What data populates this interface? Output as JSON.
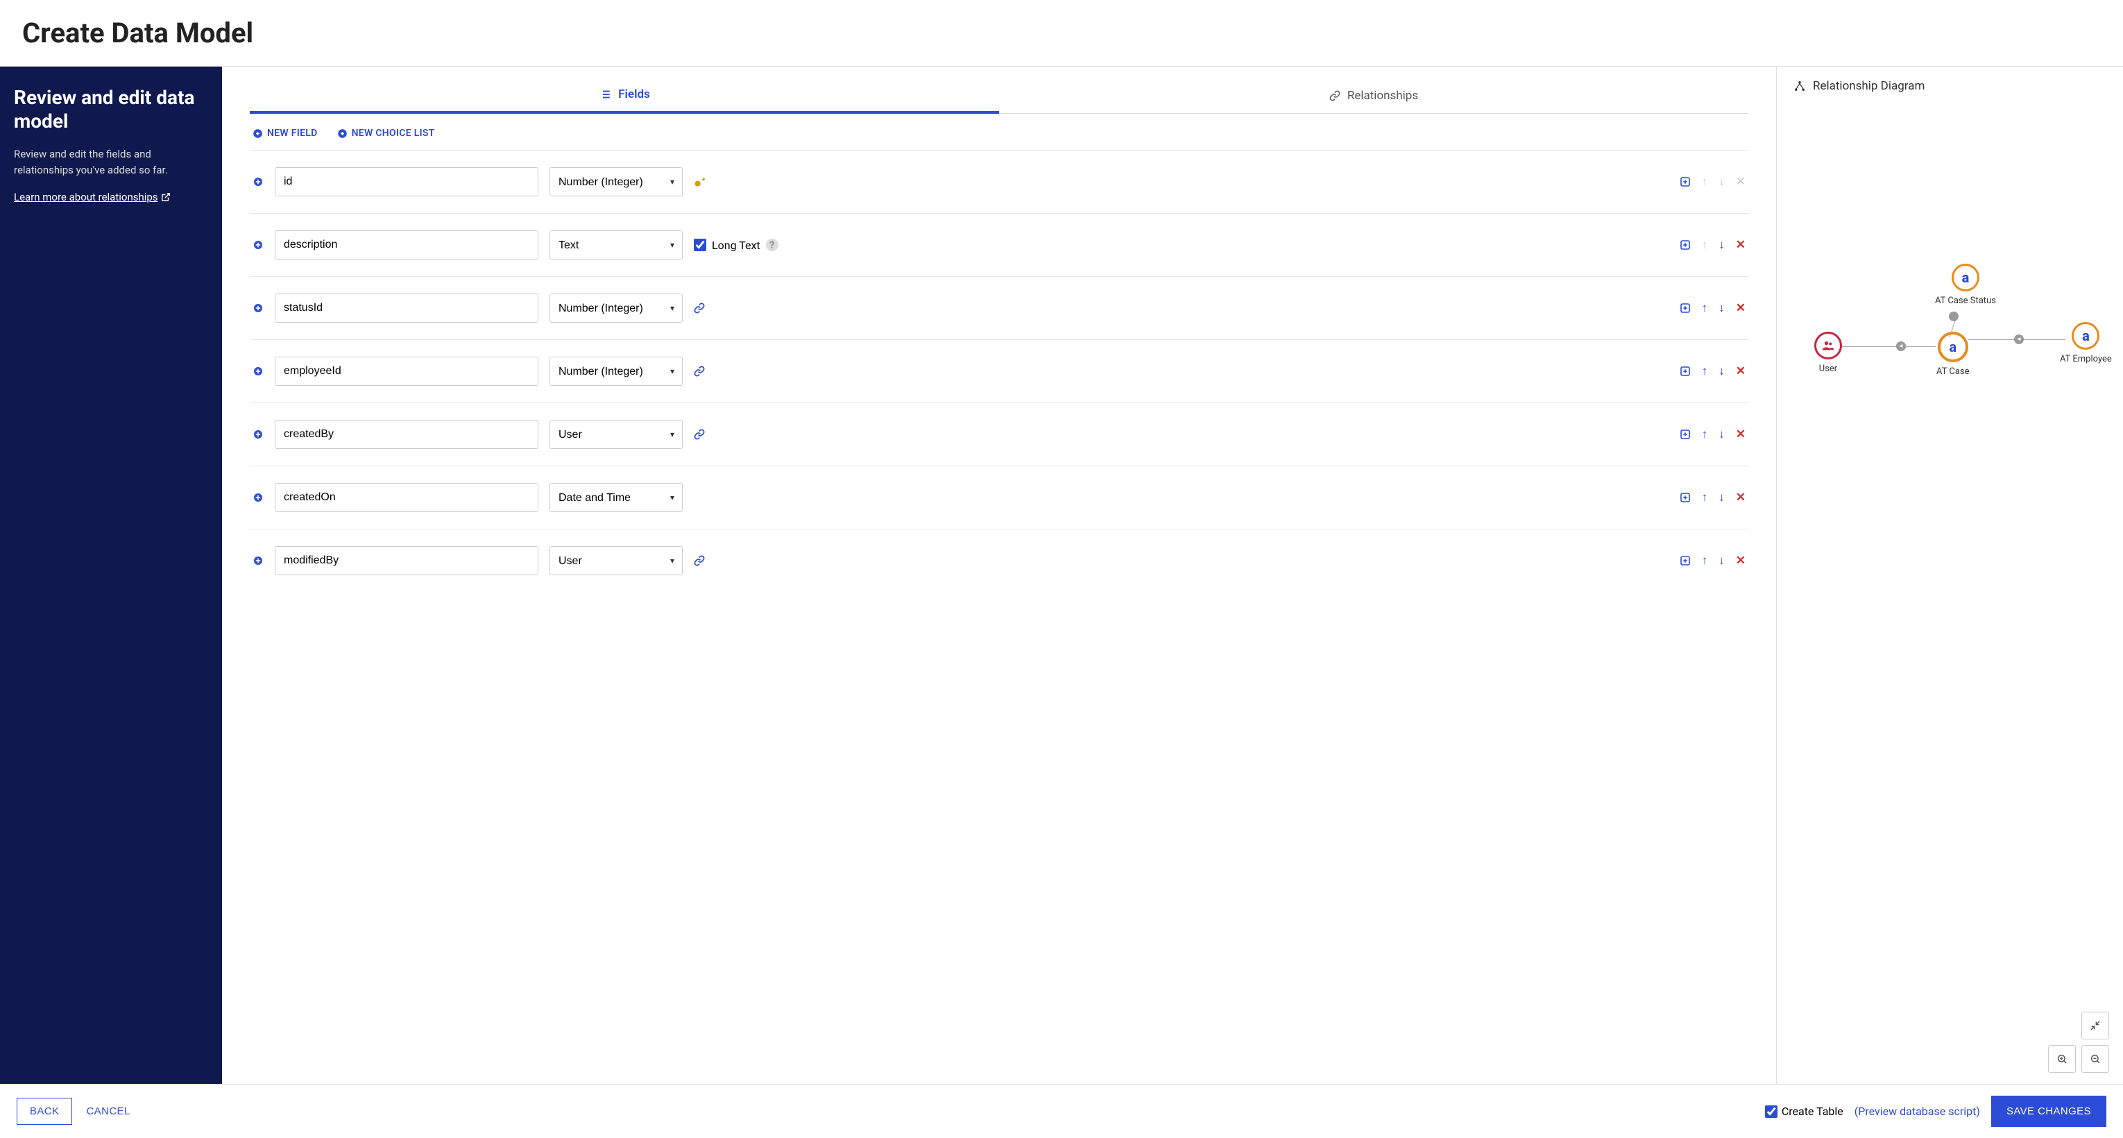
{
  "header": {
    "title": "Create Data Model"
  },
  "sidebar": {
    "heading": "Review and edit data model",
    "description": "Review and edit the fields and relationships you've added so far.",
    "learn_more": "Learn more about relationships"
  },
  "tabs": {
    "fields": "Fields",
    "relationships": "Relationships"
  },
  "actions": {
    "new_field": "NEW FIELD",
    "new_choice_list": "NEW CHOICE LIST"
  },
  "fields": [
    {
      "name": "id",
      "type": "Number (Integer)",
      "primary_key": true,
      "up_disabled": true,
      "down_disabled": true,
      "remove_disabled": true
    },
    {
      "name": "description",
      "type": "Text",
      "long_text": true,
      "long_text_label": "Long Text",
      "up_disabled": true
    },
    {
      "name": "statusId",
      "type": "Number (Integer)",
      "relationship": true
    },
    {
      "name": "employeeId",
      "type": "Number (Integer)",
      "relationship": true
    },
    {
      "name": "createdBy",
      "type": "User",
      "relationship": true
    },
    {
      "name": "createdOn",
      "type": "Date and Time"
    },
    {
      "name": "modifiedBy",
      "type": "User",
      "relationship": true
    }
  ],
  "diagram": {
    "title": "Relationship Diagram",
    "nodes": {
      "user": "User",
      "status": "AT Case Status",
      "case": "AT Case",
      "employee": "AT Employee"
    }
  },
  "footer": {
    "back": "BACK",
    "cancel": "CANCEL",
    "create_table": "Create Table",
    "preview": "(Preview database script)",
    "save": "SAVE CHANGES"
  }
}
